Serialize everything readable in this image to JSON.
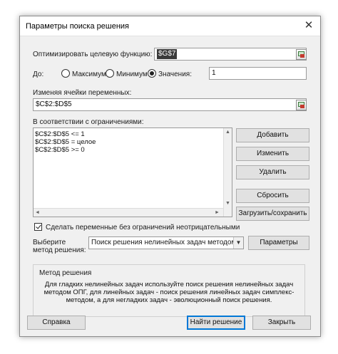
{
  "window": {
    "title": "Параметры поиска решения",
    "close_glyph": "✕"
  },
  "objective": {
    "label": "Оптимизировать целевую функцию:",
    "value": "$G$7"
  },
  "to": {
    "label": "До:",
    "options": [
      {
        "label": "Максимум",
        "selected": false
      },
      {
        "label": "Минимум",
        "selected": false
      },
      {
        "label": "Значения:",
        "selected": true
      }
    ],
    "value": "1"
  },
  "variables": {
    "label": "Изменяя ячейки переменных:",
    "value": "$C$2:$D$5"
  },
  "constraints": {
    "label": "В соответствии с ограничениями:",
    "items": [
      "$C$2:$D$5 <= 1",
      "$C$2:$D$5 = целое",
      "$C$2:$D$5 >= 0"
    ]
  },
  "buttons": {
    "add": "Добавить",
    "change": "Изменить",
    "delete": "Удалить",
    "reset": "Сбросить",
    "load_save": "Загрузить/сохранить",
    "params": "Параметры",
    "help": "Справка",
    "solve": "Найти решение",
    "close": "Закрыть"
  },
  "nonnegative": {
    "label": "Сделать переменные без ограничений неотрицательными",
    "checked": true
  },
  "method": {
    "label_line1": "Выберите",
    "label_line2": "метод решения:",
    "selected": "Поиск решения нелинейных задач методом ОПГ"
  },
  "method_group": {
    "title": "Метод решения",
    "description": "Для гладких нелинейных задач используйте поиск решения нелинейных задач методом ОПГ, для линейных задач - поиск решения линейных задач симплекс-методом, а для негладких задач - эволюционный поиск решения."
  },
  "icons": {
    "close": "close-icon",
    "ref": "cell-reference-icon",
    "dropdown": "chevron-down-icon",
    "scroll_up": "▲",
    "scroll_down": "▼",
    "scroll_left": "◄",
    "scroll_right": "►"
  }
}
